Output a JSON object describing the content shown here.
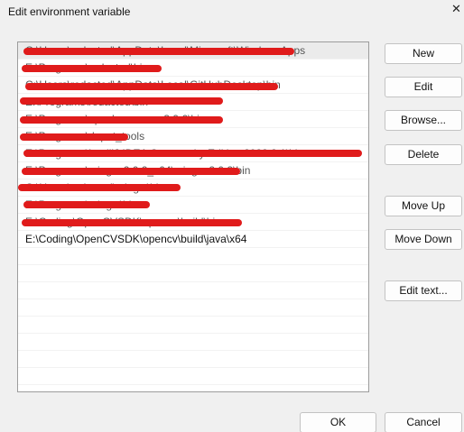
{
  "window": {
    "title": "Edit environment variable",
    "close_glyph": "✕"
  },
  "list": {
    "rows": [
      {
        "text": "C:\\Users\\redacted\\AppData\\Local\\Microsoft\\WindowsApps",
        "redacted": true,
        "selected": true
      },
      {
        "text": "E:\\Programs\\redacted\\bin",
        "redacted": true,
        "selected": false
      },
      {
        "text": "C:\\Users\\redacted\\AppData\\Local\\GitHubDesktop\\bin",
        "redacted": true,
        "selected": false
      },
      {
        "text": "E:\\Programs\\redacted\\bin",
        "redacted": true,
        "selected": false
      },
      {
        "text": "E:\\Programs\\apache-maven-3.9.6\\bin",
        "redacted": true,
        "selected": false
      },
      {
        "text": "E:\\Programs\\depot_tools",
        "redacted": true,
        "selected": false
      },
      {
        "text": "E:\\Programs\\IntelliJ IDEA Community Edition 2023.3.1\\bin",
        "redacted": true,
        "selected": false
      },
      {
        "text": "E:\\Programs\\mingw-2.0.2_x64\\mingw-2.0.2\\bin",
        "redacted": true,
        "selected": false
      },
      {
        "text": "C:\\Users\\redacted\\mingw\\bin",
        "redacted": true,
        "selected": false
      },
      {
        "text": "E:\\Programs\\mingw\\bin",
        "redacted": true,
        "selected": false
      },
      {
        "text": "E:\\Coding\\OpenCVSDK\\opencv\\build\\bin",
        "redacted": true,
        "selected": false
      },
      {
        "text": "E:\\Coding\\OpenCVSDK\\opencv\\build\\java\\x64",
        "redacted": false,
        "selected": false
      },
      {
        "text": "",
        "redacted": false,
        "selected": false
      },
      {
        "text": "",
        "redacted": false,
        "selected": false
      },
      {
        "text": "",
        "redacted": false,
        "selected": false
      },
      {
        "text": "",
        "redacted": false,
        "selected": false
      },
      {
        "text": "",
        "redacted": false,
        "selected": false
      },
      {
        "text": "",
        "redacted": false,
        "selected": false
      },
      {
        "text": "",
        "redacted": false,
        "selected": false
      },
      {
        "text": "",
        "redacted": false,
        "selected": false
      },
      {
        "text": "",
        "redacted": false,
        "selected": false
      }
    ]
  },
  "buttons": {
    "new": "New",
    "edit": "Edit",
    "browse": "Browse...",
    "delete": "Delete",
    "move_up": "Move Up",
    "move_down": "Move Down",
    "edit_text": "Edit text...",
    "ok": "OK",
    "cancel": "Cancel"
  },
  "colors": {
    "window_bg": "#f0f0f0",
    "list_bg": "#ffffff",
    "selection": "#ebebeb",
    "redaction": "#e01b1b"
  },
  "icons": {
    "close": "close-icon"
  }
}
